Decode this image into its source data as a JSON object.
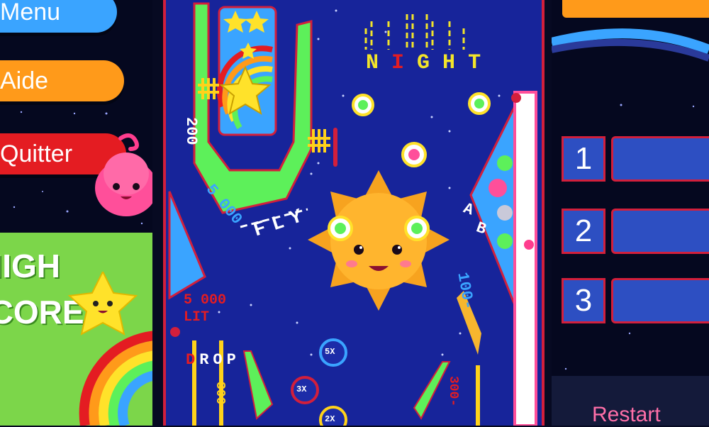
{
  "menu": {
    "menu_label": "Menu",
    "help_label": "Aide",
    "quit_label": "Quitter"
  },
  "highscore": {
    "line1": "HIGH",
    "line2": "SCORE"
  },
  "board": {
    "night_letters": [
      "N",
      "I",
      "G",
      "H",
      "T"
    ],
    "fly_label": "FLY",
    "drop_letters": [
      "D",
      "R",
      "O",
      "P"
    ],
    "ab_letters": [
      "A",
      "B"
    ],
    "score_200": "200",
    "score_5000_left": "5 000",
    "score_5000_lit": "5 000",
    "lit_label": "LIT",
    "score_100": "100-",
    "score_300_left": "300",
    "score_300_right": "300-",
    "mult_5x": "5X",
    "mult_3x": "3X",
    "mult_2x": "2X"
  },
  "leaderboard": {
    "ranks": [
      "1",
      "2",
      "3"
    ],
    "restart_label": "Restart"
  },
  "colors": {
    "board_bg": "#17249a",
    "rail_red": "#d21f3c",
    "lane_green": "#5df05a",
    "night_yellow": "#f3e52a",
    "sun_orange": "#f7a31f",
    "rank_blue": "#2d4fc2",
    "menu_blue": "#3aa4ff",
    "menu_orange": "#ff9a1a",
    "menu_red": "#e41c22"
  }
}
